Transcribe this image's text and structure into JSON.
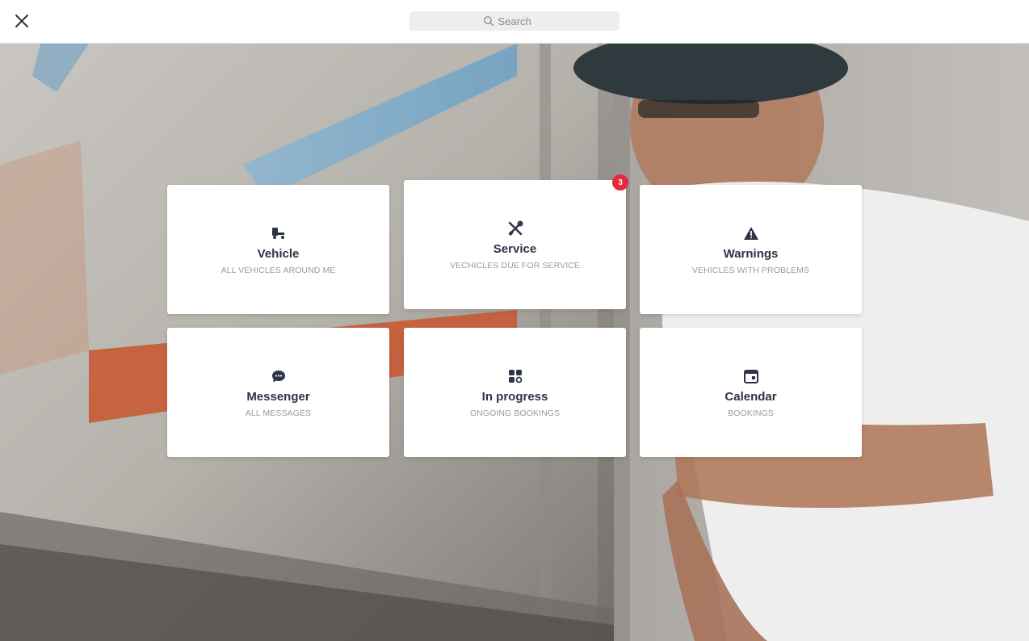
{
  "header": {
    "search_placeholder": "Search"
  },
  "cards": [
    {
      "title": "Vehicle",
      "subtitle": "ALL VEHICLES AROUND ME",
      "icon": "truck-icon"
    },
    {
      "title": "Service",
      "subtitle": "VECHICLES DUE FOR SERVICE",
      "icon": "tools-icon",
      "badge": "3"
    },
    {
      "title": "Warnings",
      "subtitle": "VEHICLES WITH PROBLEMS",
      "icon": "warning-icon"
    },
    {
      "title": "Messenger",
      "subtitle": "ALL MESSAGES",
      "icon": "chat-icon"
    },
    {
      "title": "In progress",
      "subtitle": "ONGOING BOOKINGS",
      "icon": "apps-icon"
    },
    {
      "title": "Calendar",
      "subtitle": "BOOKINGS",
      "icon": "calendar-icon"
    }
  ],
  "colors": {
    "accent": "#2c3446",
    "badge": "#e8283c",
    "subtitle": "#9a9a9a"
  }
}
